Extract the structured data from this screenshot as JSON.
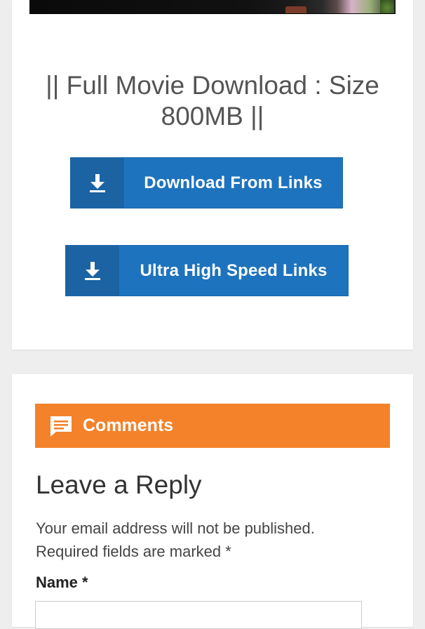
{
  "download_section": {
    "title": "|| Full Movie Download : Size 800MB ||",
    "buttons": [
      {
        "label": "Download From Links",
        "icon": "download-icon"
      },
      {
        "label": "Ultra High Speed Links",
        "icon": "download-icon"
      }
    ]
  },
  "comments": {
    "header_label": "Comments",
    "header_icon": "comment-icon",
    "reply_title": "Leave a Reply",
    "notes_line1": "Your email address will not be published.",
    "notes_line2": "Required fields are marked *",
    "name_label": "Name *",
    "name_value": ""
  },
  "colors": {
    "button_blue": "#1e73be",
    "button_icon_blue": "#1b63a3",
    "comments_orange": "#f4822a",
    "title_gray": "#545454"
  }
}
